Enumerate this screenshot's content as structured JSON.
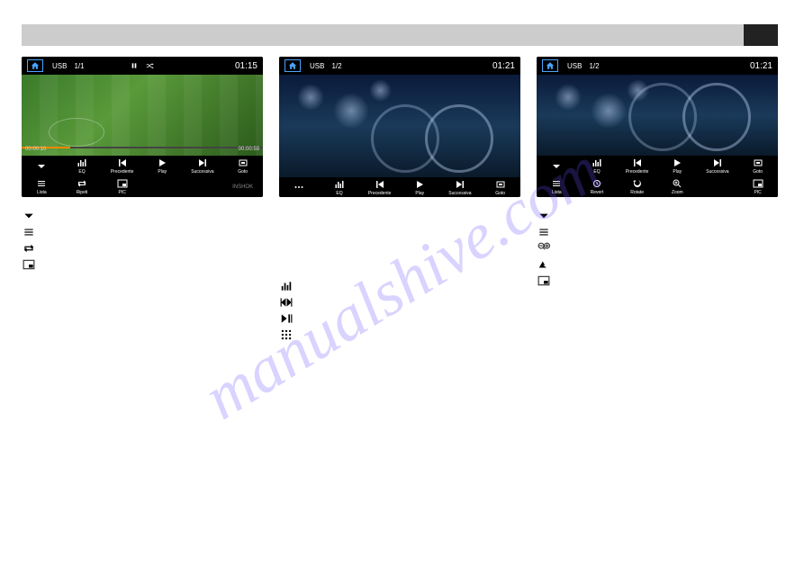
{
  "watermark": "manualshive.com",
  "screens": [
    {
      "source": "USB",
      "track": "1/1",
      "clock": "01:15",
      "elapsed": "00:00:10",
      "total": "00:00:59",
      "showPauseShuffle": true,
      "content": "field",
      "row1": [
        {
          "icon": "chevron-down",
          "label": ""
        },
        {
          "icon": "eq",
          "label": "EQ"
        },
        {
          "icon": "prev",
          "label": "Precedente"
        },
        {
          "icon": "play",
          "label": "Play"
        },
        {
          "icon": "next",
          "label": "Successiva"
        },
        {
          "icon": "goto",
          "label": "Goto"
        }
      ],
      "row2": [
        {
          "icon": "list",
          "label": "Lista"
        },
        {
          "icon": "repeat",
          "label": "Ripeti"
        },
        {
          "icon": "pic",
          "label": "PIC"
        },
        {
          "icon": "",
          "label": ""
        },
        {
          "icon": "",
          "label": ""
        },
        {
          "icon": "brand",
          "label": ""
        }
      ]
    },
    {
      "source": "USB",
      "track": "1/2",
      "clock": "01:21",
      "content": "bike",
      "row1": [
        {
          "icon": "dots",
          "label": ""
        },
        {
          "icon": "eq",
          "label": "EQ"
        },
        {
          "icon": "prev",
          "label": "Precedente"
        },
        {
          "icon": "play",
          "label": "Play"
        },
        {
          "icon": "next",
          "label": "Successiva"
        },
        {
          "icon": "goto",
          "label": "Goto"
        }
      ]
    },
    {
      "source": "USB",
      "track": "1/2",
      "clock": "01:21",
      "content": "bike",
      "row1": [
        {
          "icon": "chevron-down",
          "label": ""
        },
        {
          "icon": "eq",
          "label": "EQ"
        },
        {
          "icon": "prev",
          "label": "Precedente"
        },
        {
          "icon": "play",
          "label": "Play"
        },
        {
          "icon": "next",
          "label": "Successiva"
        },
        {
          "icon": "goto",
          "label": "Goto"
        }
      ],
      "row2": [
        {
          "icon": "list",
          "label": "Lista"
        },
        {
          "icon": "revert",
          "label": "Revert"
        },
        {
          "icon": "rotate",
          "label": "Rotate"
        },
        {
          "icon": "zoom",
          "label": "Zoom"
        },
        {
          "icon": "",
          "label": ""
        },
        {
          "icon": "pic",
          "label": "PIC"
        }
      ]
    }
  ],
  "legends": {
    "col1": [
      {
        "icon": "chevron-down"
      },
      {
        "icon": "list"
      },
      {
        "icon": "repeat"
      },
      {
        "icon": "pic-small"
      }
    ],
    "col2": [
      {
        "icon": "eq"
      },
      {
        "icon": "prevnext"
      },
      {
        "icon": "playpause"
      },
      {
        "icon": "grid"
      }
    ],
    "col3": [
      {
        "icon": "chevron-down"
      },
      {
        "icon": "list"
      },
      {
        "icon": "zoominout"
      },
      {
        "icon": "rotate-tri"
      },
      {
        "icon": "pic-small"
      }
    ]
  }
}
